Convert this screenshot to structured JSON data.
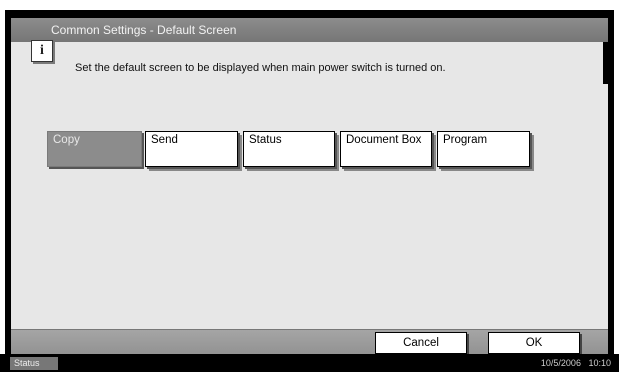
{
  "window": {
    "title": "Common Settings - Default Screen"
  },
  "info": {
    "icon": "info-icon",
    "icon_glyph": "i",
    "message": "Set the default screen to be displayed when main power switch is turned on."
  },
  "options": [
    {
      "label": "Copy",
      "selected": true
    },
    {
      "label": "Send",
      "selected": false
    },
    {
      "label": "Status",
      "selected": false
    },
    {
      "label": "Document Box",
      "selected": false
    },
    {
      "label": "Program",
      "selected": false
    }
  ],
  "actions": {
    "cancel_label": "Cancel",
    "ok_label": "OK"
  },
  "status_bar": {
    "status_label": "Status",
    "date": "10/5/2006",
    "time": "10:10"
  }
}
